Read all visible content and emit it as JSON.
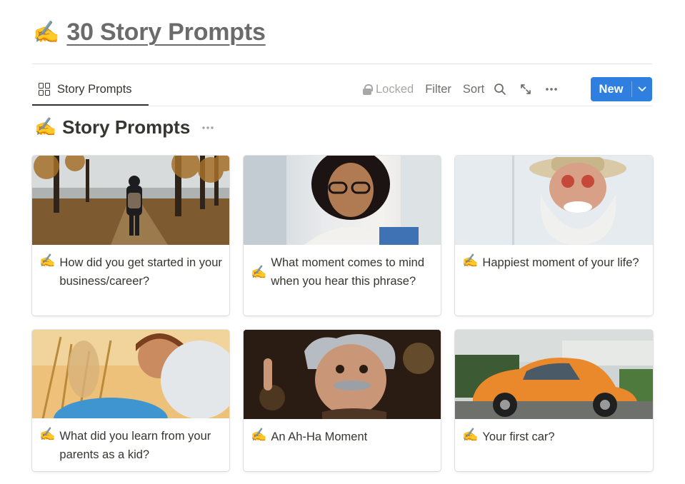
{
  "page": {
    "title_emoji": "✍️",
    "title": "30 Story Prompts"
  },
  "view": {
    "tab_label": "Story Prompts",
    "tab_icon": "gallery-grid-icon"
  },
  "toolbar": {
    "locked_label": "Locked",
    "filter_label": "Filter",
    "sort_label": "Sort",
    "search_icon": "search-icon",
    "expand_icon": "expand-icon",
    "more_icon": "more-icon",
    "new_label": "New",
    "new_color": "#2e7fe0"
  },
  "database": {
    "title_emoji": "✍️",
    "title": "Story Prompts"
  },
  "cards": [
    {
      "emoji": "✍️",
      "title": "How did you get started in your business/career?",
      "cover": "autumn-forest-path"
    },
    {
      "emoji": "✍️",
      "title": "What moment comes to mind when you hear this phrase?",
      "cover": "woman-with-glasses"
    },
    {
      "emoji": "✍️",
      "title": "Happiest moment of your life?",
      "cover": "smiling-old-man"
    },
    {
      "emoji": "✍️",
      "title": "What did you learn from your parents as a kid?",
      "cover": "child-with-balloons"
    },
    {
      "emoji": "✍️",
      "title": "An Ah-Ha Moment",
      "cover": "einstein-figurine"
    },
    {
      "emoji": "✍️",
      "title": "Your first car?",
      "cover": "orange-beetle-car"
    }
  ]
}
